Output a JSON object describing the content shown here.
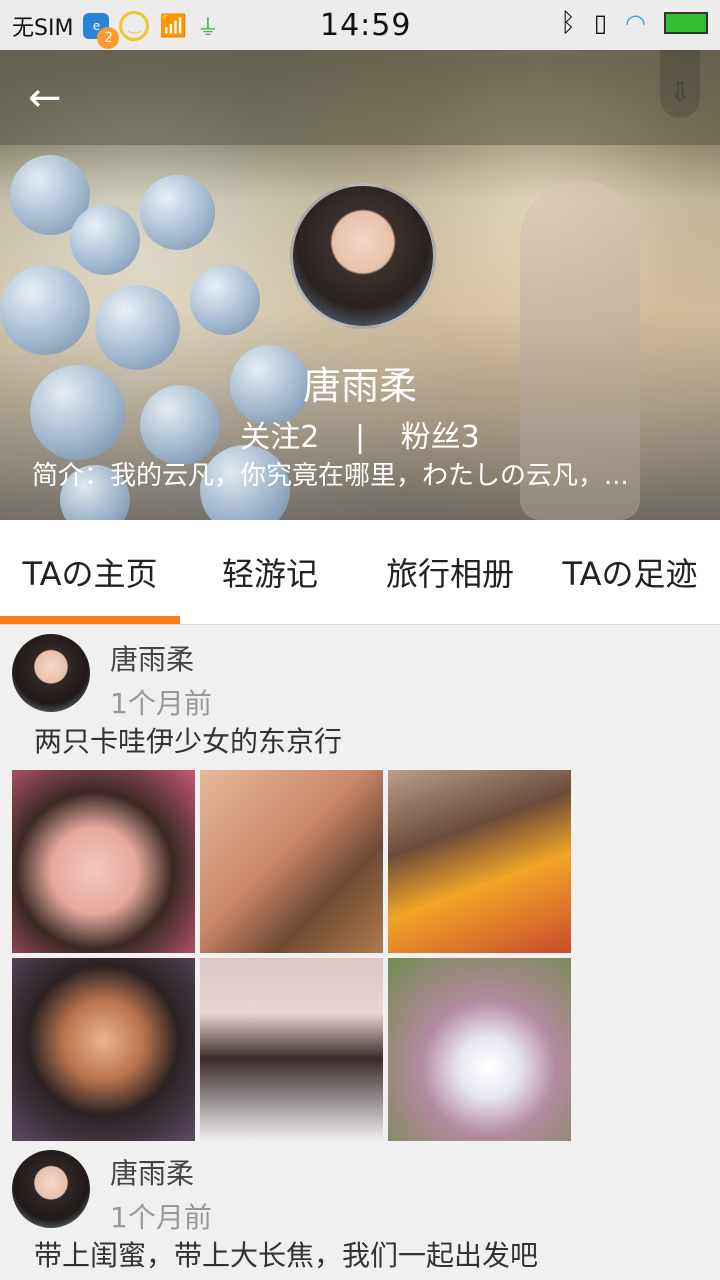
{
  "status_bar": {
    "carrier": "无SIM",
    "badge_count": "2",
    "time": "14:59",
    "icons": [
      "weibo-badge-icon",
      "smiley-icon",
      "antenna-icon",
      "usb-icon",
      "bluetooth-icon",
      "vibrate-icon",
      "wifi-icon",
      "battery-icon"
    ]
  },
  "header": {
    "back_icon": "arrow-left-icon",
    "download_icon": "download-icon"
  },
  "profile": {
    "name": "唐雨柔",
    "following": "关注2",
    "separator": "|",
    "followers": "粉丝3",
    "intro": "简介：我的云凡，你究竟在哪里，わたしの云凡，..."
  },
  "tabs": [
    {
      "label": "TAの主页",
      "active": true
    },
    {
      "label": "轻游记",
      "active": false
    },
    {
      "label": "旅行相册",
      "active": false
    },
    {
      "label": "TAの足迹",
      "active": false
    }
  ],
  "posts": [
    {
      "author": "唐雨柔",
      "time": "1个月前",
      "text": "两只卡哇伊少女的东京行",
      "photo_count": 6
    },
    {
      "author": "唐雨柔",
      "time": "1个月前",
      "text": "带上闺蜜，带上大长焦，我们一起出发吧"
    }
  ],
  "colors": {
    "accent": "#ff7a1a",
    "tab_bg": "#ffffff",
    "feed_bg": "#f0f0f0"
  }
}
